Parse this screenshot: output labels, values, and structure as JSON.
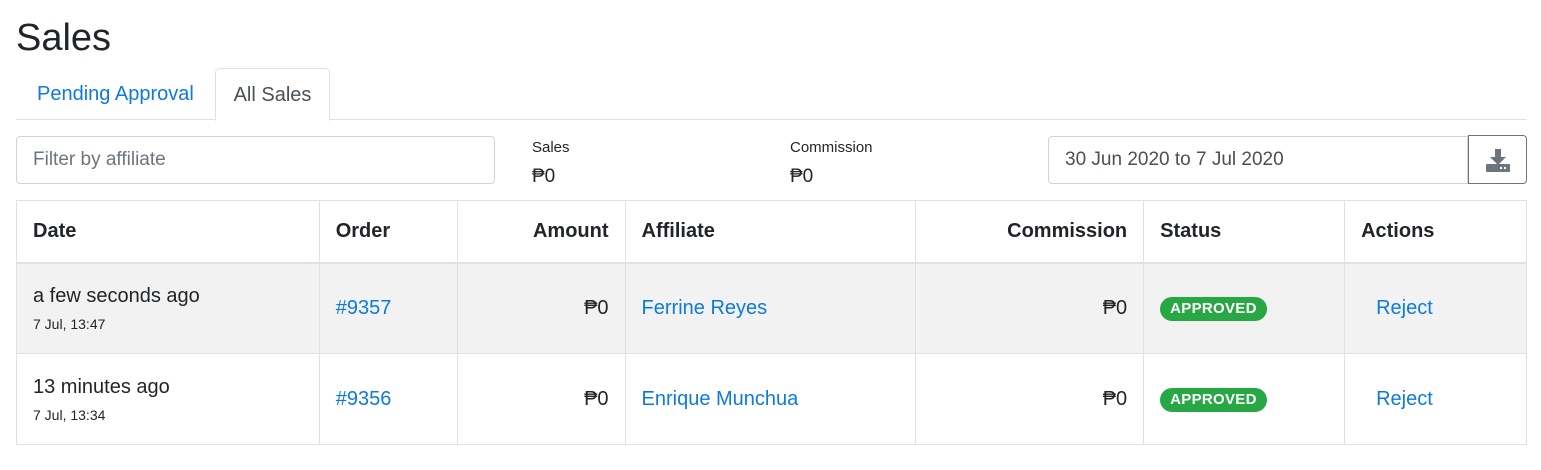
{
  "page": {
    "title": "Sales"
  },
  "tabs": [
    {
      "label": "Pending Approval",
      "active": false
    },
    {
      "label": "All Sales",
      "active": true
    }
  ],
  "filter": {
    "placeholder": "Filter by affiliate",
    "value": ""
  },
  "stats": {
    "sales": {
      "label": "Sales",
      "value": "₱0"
    },
    "commission": {
      "label": "Commission",
      "value": "₱0"
    }
  },
  "date_range": {
    "value": "30 Jun 2020 to 7 Jul 2020"
  },
  "download": {
    "icon": "download-icon"
  },
  "table": {
    "columns": [
      "Date",
      "Order",
      "Amount",
      "Affiliate",
      "Commission",
      "Status",
      "Actions"
    ],
    "rows": [
      {
        "date_relative": "a few seconds ago",
        "date_exact": "7 Jul, 13:47",
        "order": "#9357",
        "amount": "₱0",
        "affiliate": "Ferrine Reyes",
        "commission": "₱0",
        "status": "APPROVED",
        "action": "Reject"
      },
      {
        "date_relative": "13 minutes ago",
        "date_exact": "7 Jul, 13:34",
        "order": "#9356",
        "amount": "₱0",
        "affiliate": "Enrique Munchua",
        "commission": "₱0",
        "status": "APPROVED",
        "action": "Reject"
      }
    ]
  },
  "colors": {
    "link": "#0d7ae0",
    "approved": "#28a745",
    "stripe": "#f2f2f2"
  }
}
